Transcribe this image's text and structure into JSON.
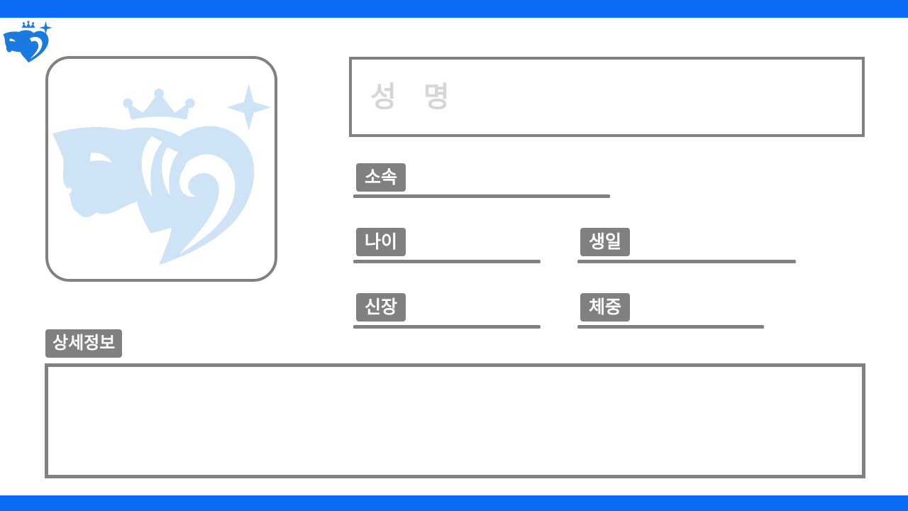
{
  "form": {
    "name_placeholder": "성 명",
    "fields": {
      "affiliation": "소속",
      "age": "나이",
      "birthday": "생일",
      "height": "신장",
      "weight": "체중"
    },
    "details_label": "상세정보"
  },
  "colors": {
    "band": "#0b6cf7",
    "frame": "#808080",
    "emblem": "#cfe3f6",
    "placeholder": "#d6d6d6"
  },
  "icons": {
    "logo": "horse-heart-crown-emblem",
    "watermark": "horse-heart-crown-emblem"
  }
}
